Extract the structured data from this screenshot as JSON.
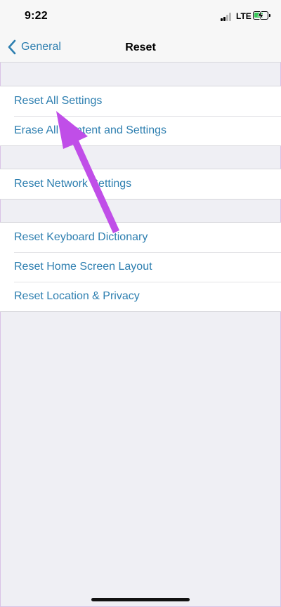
{
  "status_bar": {
    "time": "9:22",
    "network": "LTE",
    "battery_level_pct": 70,
    "signal_bars_active": 2,
    "signal_bars_total": 4
  },
  "nav": {
    "back_label": "General",
    "title": "Reset"
  },
  "groups": [
    {
      "items": [
        "Reset All Settings",
        "Erase All Content and Settings"
      ]
    },
    {
      "items": [
        "Reset Network Settings"
      ]
    },
    {
      "items": [
        "Reset Keyboard Dictionary",
        "Reset Home Screen Layout",
        "Reset Location & Privacy"
      ]
    }
  ],
  "colors": {
    "link": "#2e7fb0",
    "annotation_arrow": "#c04ee8",
    "background": "#efeff4",
    "battery": "#37c759"
  },
  "icons": {
    "back": "chevron-left-icon",
    "signal": "cellular-signal-icon",
    "battery": "battery-charging-icon"
  }
}
